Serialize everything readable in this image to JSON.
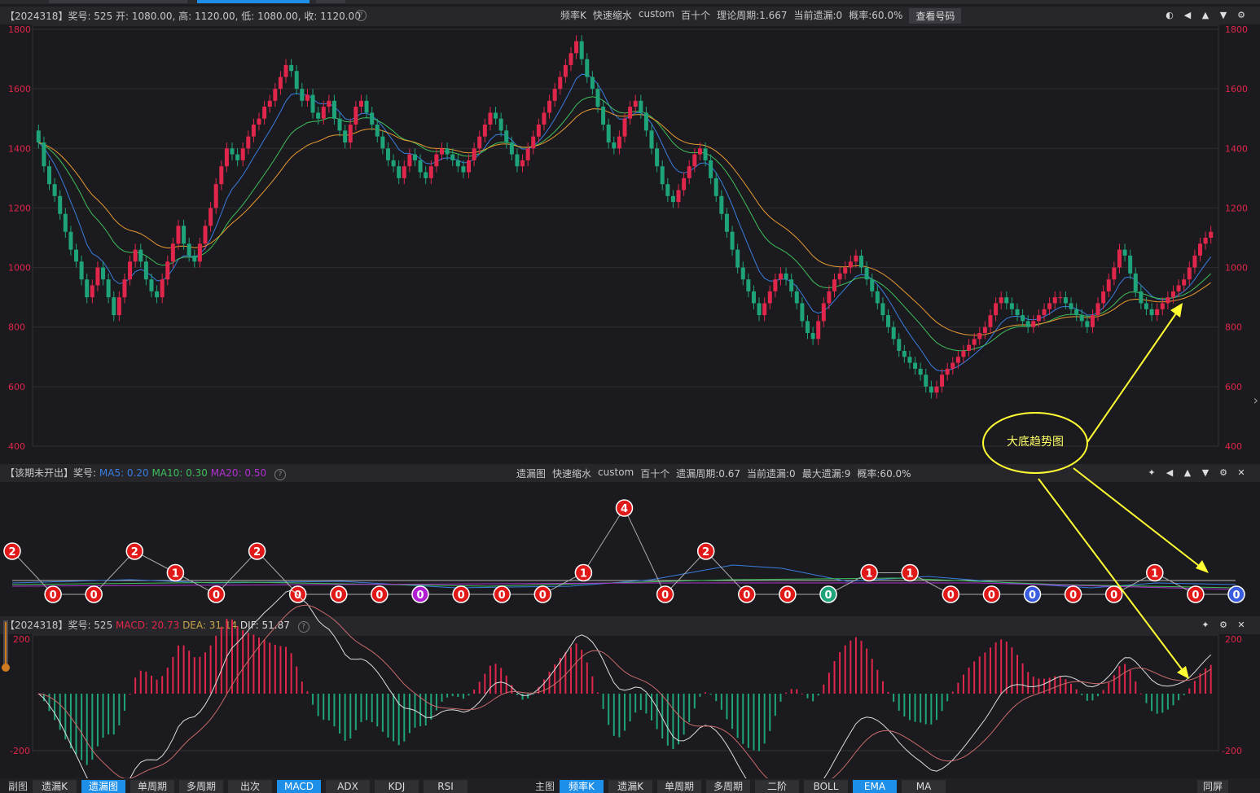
{
  "panel1": {
    "info": "【2024318】奖号: 525  开: 1080.00, 高: 1120.00, 低: 1080.00, 收: 1120.00",
    "tags": [
      "频率K",
      "快速缩水",
      "custom",
      "百十个",
      "理论周期:1.667",
      "当前遗漏:0",
      "概率:60.0%"
    ],
    "button": "查看号码",
    "y_ticks": [
      "1800",
      "1600",
      "1400",
      "1200",
      "1000",
      "800",
      "600",
      "400"
    ]
  },
  "panel2": {
    "info_prefix": "【该期未开出】奖号:",
    "ma5": "MA5: 0.20",
    "ma10": "MA10: 0.30",
    "ma20": "MA20: 0.50",
    "tags": [
      "遗漏图",
      "快速缩水",
      "custom",
      "百十个",
      "遗漏周期:0.67",
      "当前遗漏:0",
      "最大遗漏:9",
      "概率:60.0%"
    ]
  },
  "panel3": {
    "info_prefix": "【2024318】奖号: 525",
    "macd": "MACD: 20.73",
    "dea": "DEA: 31.14",
    "dif": "DIF: 51.87",
    "y_top": "200",
    "y_bottom": "-200"
  },
  "annotation": {
    "text": "大底趋势图",
    "color": "#ffff33"
  },
  "bottom": {
    "left_label": "副图",
    "left_tabs": [
      {
        "label": "遗漏K",
        "on": false
      },
      {
        "label": "遗漏图",
        "on": true
      },
      {
        "label": "单周期",
        "on": false
      },
      {
        "label": "多周期",
        "on": false
      },
      {
        "label": "出次",
        "on": false
      },
      {
        "label": "MACD",
        "on": true
      },
      {
        "label": "ADX",
        "on": false
      },
      {
        "label": "KDJ",
        "on": false
      },
      {
        "label": "RSI",
        "on": false
      }
    ],
    "right_label": "主图",
    "right_tabs": [
      {
        "label": "频率K",
        "on": true
      },
      {
        "label": "遗漏K",
        "on": false
      },
      {
        "label": "单周期",
        "on": false
      },
      {
        "label": "多周期",
        "on": false
      },
      {
        "label": "二阶",
        "on": false
      },
      {
        "label": "BOLL",
        "on": false
      },
      {
        "label": "EMA",
        "on": true
      },
      {
        "label": "MA",
        "on": false
      }
    ],
    "far_right": "同屏"
  },
  "colors": {
    "up": "#e0264a",
    "down": "#1fa37a",
    "ema_fast": "#3a7de0",
    "ema_mid": "#3fbf5a",
    "ema_slow": "#e89a30"
  },
  "chart_data": [
    {
      "type": "candlestick",
      "title": "频率K",
      "ylim": [
        400,
        1800
      ],
      "close": [
        1420,
        1340,
        1280,
        1240,
        1180,
        1120,
        1060,
        1020,
        960,
        900,
        940,
        1000,
        960,
        900,
        840,
        900,
        960,
        1020,
        1060,
        1020,
        960,
        920,
        900,
        960,
        1020,
        1080,
        1140,
        1080,
        1040,
        1020,
        1080,
        1140,
        1200,
        1280,
        1340,
        1400,
        1380,
        1360,
        1400,
        1440,
        1480,
        1500,
        1540,
        1560,
        1600,
        1640,
        1680,
        1660,
        1600,
        1560,
        1580,
        1520,
        1500,
        1540,
        1560,
        1500,
        1460,
        1420,
        1480,
        1540,
        1560,
        1520,
        1480,
        1440,
        1400,
        1360,
        1340,
        1300,
        1340,
        1380,
        1360,
        1320,
        1300,
        1340,
        1380,
        1400,
        1380,
        1360,
        1340,
        1320,
        1360,
        1400,
        1440,
        1480,
        1520,
        1500,
        1460,
        1420,
        1380,
        1340,
        1360,
        1400,
        1440,
        1480,
        1520,
        1560,
        1600,
        1640,
        1680,
        1720,
        1760,
        1700,
        1640,
        1600,
        1540,
        1480,
        1420,
        1400,
        1440,
        1500,
        1540,
        1560,
        1520,
        1460,
        1400,
        1340,
        1280,
        1240,
        1220,
        1260,
        1300,
        1340,
        1380,
        1400,
        1360,
        1300,
        1240,
        1180,
        1120,
        1060,
        1000,
        960,
        920,
        880,
        840,
        880,
        920,
        960,
        980,
        960,
        920,
        880,
        820,
        780,
        760,
        820,
        880,
        920,
        960,
        980,
        1000,
        1020,
        1040,
        1000,
        960,
        920,
        880,
        840,
        800,
        760,
        720,
        700,
        680,
        660,
        640,
        600,
        580,
        600,
        640,
        660,
        680,
        700,
        720,
        740,
        760,
        780,
        800,
        840,
        880,
        900,
        880,
        860,
        840,
        820,
        800,
        820,
        840,
        860,
        880,
        900,
        900,
        880,
        860,
        840,
        820,
        800,
        840,
        880,
        920,
        960,
        1000,
        1060,
        1040,
        980,
        920,
        880,
        860,
        840,
        860,
        880,
        900,
        920,
        940,
        960,
        1000,
        1040,
        1080,
        1100,
        1120
      ]
    },
    {
      "type": "line",
      "title": "遗漏图",
      "series": [
        {
          "name": "",
          "values": [
            2,
            0,
            0,
            2,
            1,
            0,
            2,
            0,
            0,
            0,
            0,
            0,
            0,
            0,
            1,
            4,
            0,
            2,
            0,
            0,
            0,
            1,
            1,
            0,
            0,
            0,
            0,
            0,
            1,
            0,
            0
          ]
        }
      ]
    },
    {
      "type": "bar",
      "title": "MACD",
      "ylim": [
        -200,
        200
      ],
      "series": [
        {
          "name": "MACD",
          "values": [
            20.73
          ]
        },
        {
          "name": "DEA",
          "values": [
            31.14
          ]
        },
        {
          "name": "DIF",
          "values": [
            51.87
          ]
        }
      ]
    }
  ]
}
